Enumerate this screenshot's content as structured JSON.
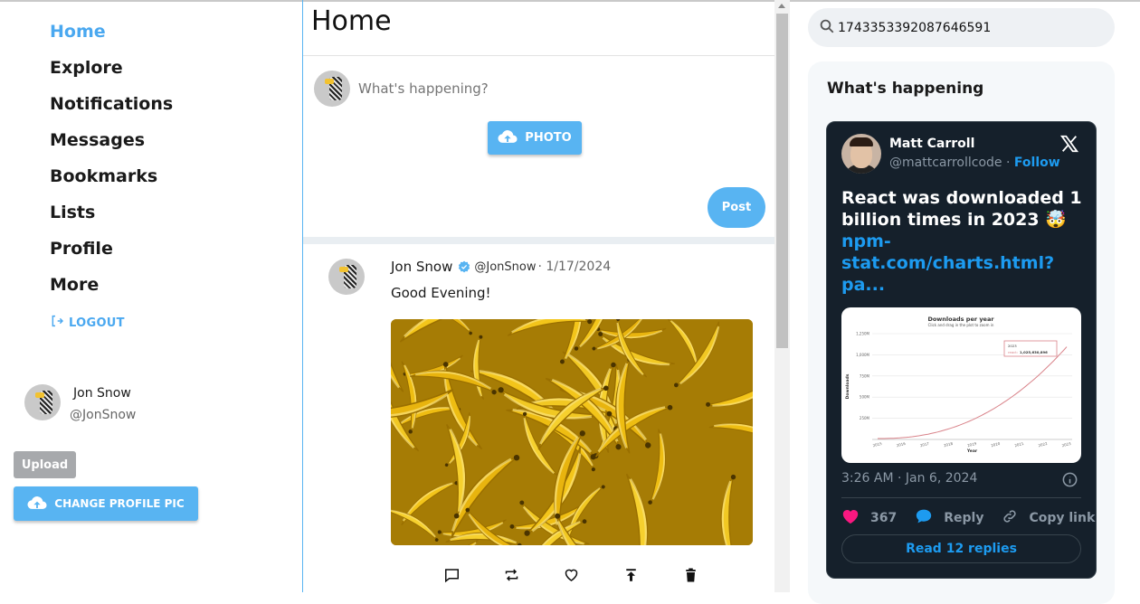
{
  "sidebar": {
    "nav": [
      {
        "label": "Home",
        "active": true
      },
      {
        "label": "Explore"
      },
      {
        "label": "Notifications"
      },
      {
        "label": "Messages"
      },
      {
        "label": "Bookmarks"
      },
      {
        "label": "Lists"
      },
      {
        "label": "Profile"
      },
      {
        "label": "More"
      }
    ],
    "logout_label": "LOGOUT",
    "user": {
      "name": "Jon Snow",
      "handle": "@JonSnow"
    },
    "upload_label": "Upload",
    "change_pic_label": "CHANGE PROFILE PIC"
  },
  "main": {
    "title": "Home",
    "composer": {
      "placeholder": "What's happening?",
      "photo_label": "PHOTO",
      "post_label": "Post"
    },
    "tweet": {
      "name": "Jon Snow",
      "handle": "@JonSnow",
      "date": "· 1/17/2024",
      "text": "Good Evening!",
      "image": "bananas-photo",
      "actions": [
        "comment-icon",
        "retweet-icon",
        "heart-icon",
        "share-icon",
        "delete-icon"
      ]
    }
  },
  "right": {
    "search_value": "174335339208764659​1",
    "panel_title": "What's happening",
    "embed": {
      "name": "Matt Carroll",
      "handle": "@mattcarrollcode",
      "separator": " · ",
      "follow_label": "Follow",
      "text": "React was downloaded 1 billion times in 2023 🤯",
      "link": "npm-stat.com/charts.html?pa...",
      "time": "3:26 AM · Jan 6, 2024",
      "likes": "367",
      "reply_label": "Reply",
      "copy_label": "Copy link",
      "read_label": "Read 12 replies",
      "chart": {
        "title": "Downloads per year",
        "subtitle": "Click and drag in the plot to zoom in",
        "ylabel": "Downloads",
        "xlabel": "Year",
        "y_ticks": [
          "1,250M",
          "1,000M",
          "750M",
          "500M",
          "250M"
        ],
        "x_ticks": [
          "2015",
          "2016",
          "2017",
          "2018",
          "2019",
          "2020",
          "2021",
          "2022",
          "2023"
        ],
        "tooltip_year": "2023",
        "tooltip_series": "react:",
        "tooltip_value": "1,025,630,896"
      }
    }
  },
  "colors": {
    "accent": "#58b4f2",
    "link": "#1d9bf0",
    "embed_bg": "#15202b",
    "heart": "#f91880"
  }
}
